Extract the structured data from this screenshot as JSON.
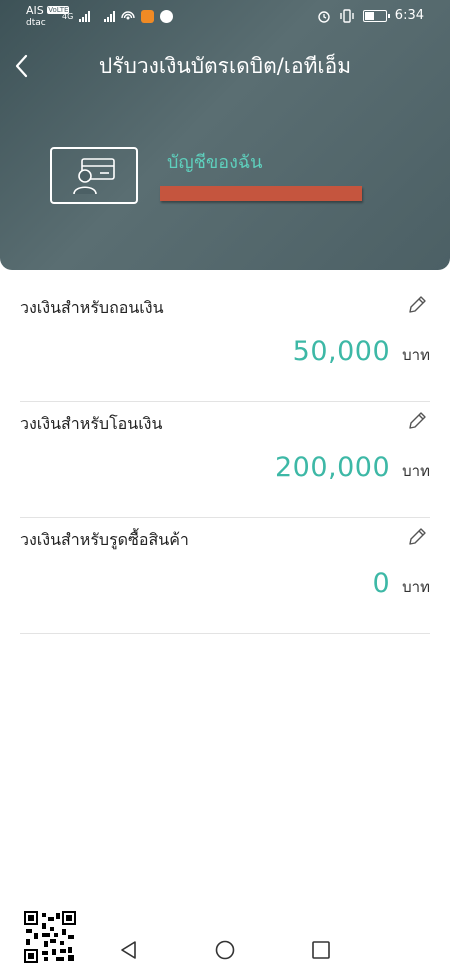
{
  "status_bar": {
    "carrier_primary": "AIS",
    "carrier_primary_badge": "VoLTE",
    "network_type": "4G",
    "carrier_secondary": "dtac",
    "time": "6:34",
    "icons": [
      "signal-icon",
      "wifi-hotspot-icon",
      "app-notification-icon",
      "app-notification-icon",
      "alarm-icon",
      "vibrate-icon",
      "battery-icon"
    ]
  },
  "header": {
    "title": "ปรับวงเงินบัตรเดบิต/เอทีเอ็ม",
    "back_icon": "chevron-left-icon",
    "card_icon": "debit-card-user-icon",
    "account_label": "บัญชีของฉัน"
  },
  "limits": [
    {
      "label": "วงเงินสำหรับถอนเงิน",
      "amount": "50,000",
      "currency": "บาท",
      "edit_icon": "pencil-icon"
    },
    {
      "label": "วงเงินสำหรับโอนเงิน",
      "amount": "200,000",
      "currency": "บาท",
      "edit_icon": "pencil-icon"
    },
    {
      "label": "วงเงินสำหรับรูดซื้อสินค้า",
      "amount": "0",
      "currency": "บาท",
      "edit_icon": "pencil-icon"
    }
  ],
  "nav_bar": {
    "icons": [
      "triangle-back-icon",
      "circle-home-icon",
      "square-recents-icon",
      "qr-code-icon"
    ]
  },
  "colors": {
    "header_bg": "#4c6065",
    "accent_teal": "#3db8a6",
    "account_label": "#5ed0bd",
    "redaction_bar": "#c5553e",
    "divider": "#e3e3e3"
  }
}
